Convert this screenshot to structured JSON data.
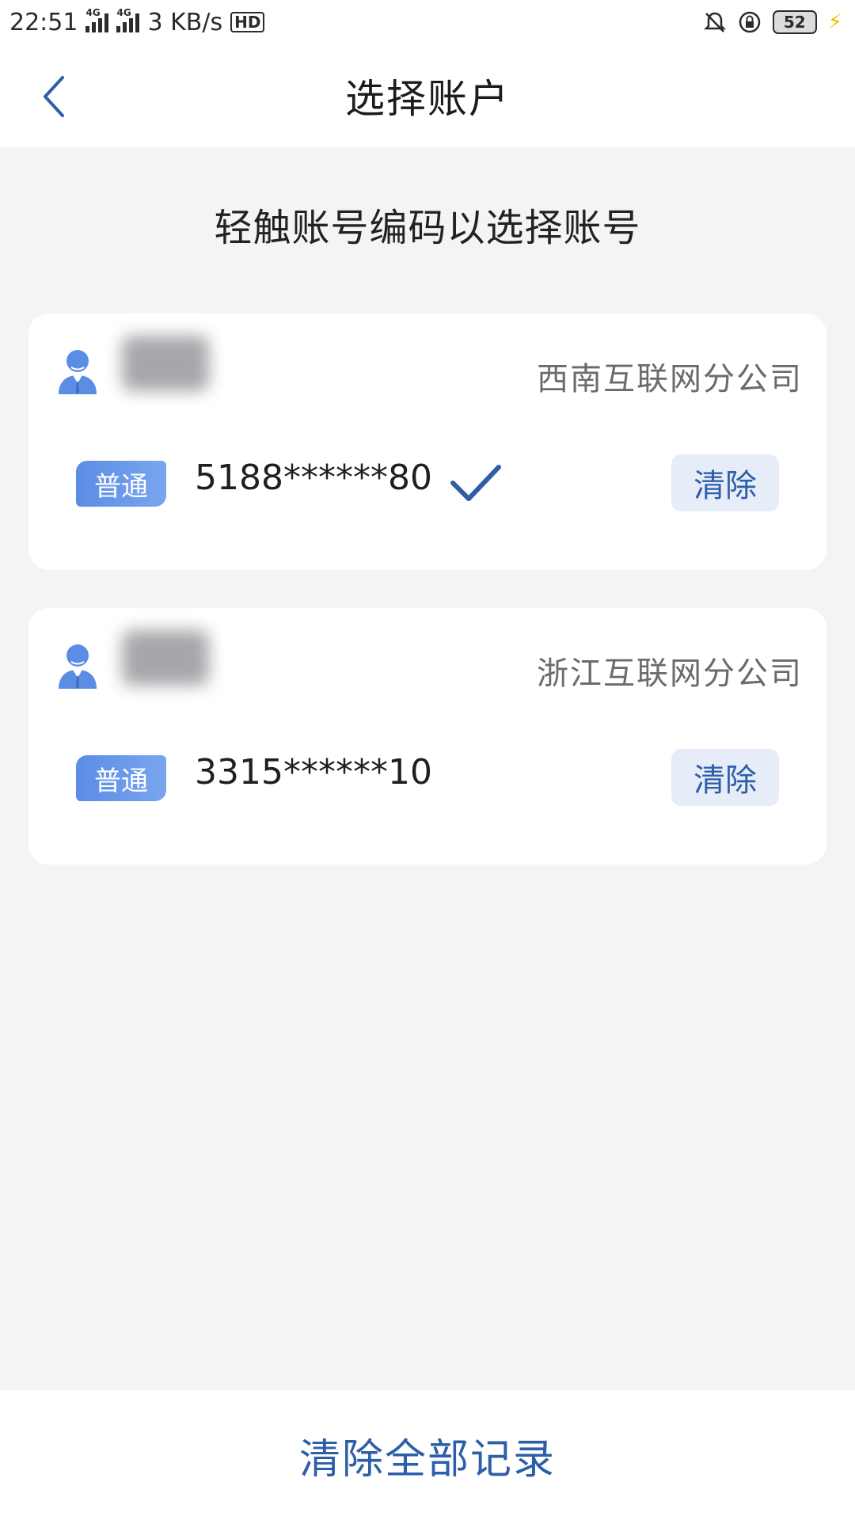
{
  "status_bar": {
    "time": "22:51",
    "net1": "4G",
    "net2": "4G",
    "speed": "3 KB/s",
    "hd": "HD",
    "battery": "52"
  },
  "header": {
    "title": "选择账户"
  },
  "hint": "轻触账号编码以选择账号",
  "accounts": [
    {
      "company": "西南互联网分公司",
      "type": "普通",
      "number": "5188******80",
      "selected": true,
      "clear_label": "清除"
    },
    {
      "company": "浙江互联网分公司",
      "type": "普通",
      "number": "3315******10",
      "selected": false,
      "clear_label": "清除"
    }
  ],
  "footer": {
    "clear_all_label": "清除全部记录"
  },
  "colors": {
    "accent": "#2d5ea8",
    "badge": "#5b8de4",
    "background": "#f3f4f6"
  }
}
